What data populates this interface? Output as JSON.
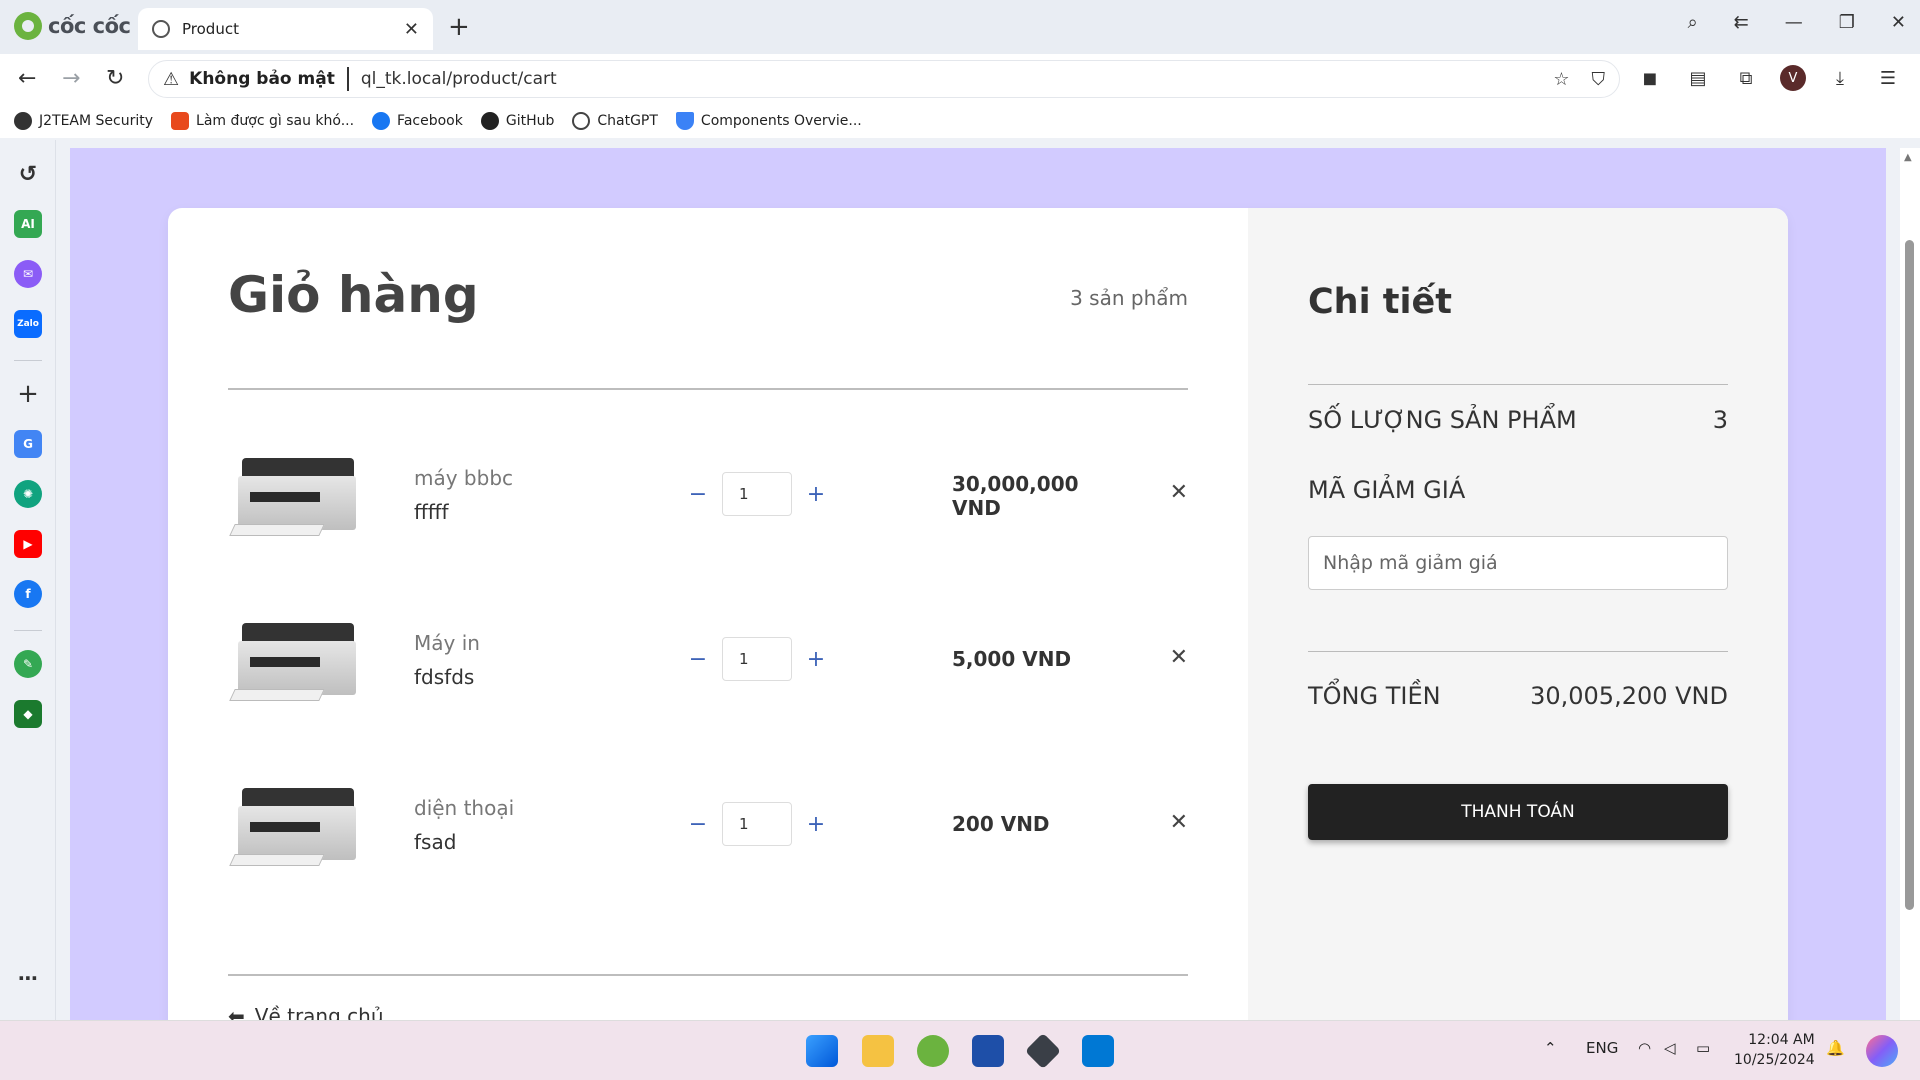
{
  "browser": {
    "brand": "cốc cốc",
    "tab_title": "Product",
    "security_label": "Không bảo mật",
    "url": "ql_tk.local/product/cart",
    "avatar_letter": "V",
    "bookmarks": [
      {
        "label": "J2TEAM Security",
        "color": "#333333"
      },
      {
        "label": "Làm được gì sau khó...",
        "color": "#e8491d"
      },
      {
        "label": "Facebook",
        "color": "#1877f2"
      },
      {
        "label": "GitHub",
        "color": "#222222"
      },
      {
        "label": "ChatGPT",
        "color": "#444444"
      },
      {
        "label": "Components Overvie...",
        "color": "#3b82f6"
      }
    ]
  },
  "sidebar": {
    "items": [
      "history-icon",
      "ai-icon",
      "messenger-icon",
      "zalo-icon",
      "add-icon",
      "translate-icon",
      "chatgpt-icon",
      "youtube-icon",
      "facebook-icon",
      "notes-icon",
      "game-icon",
      "more-icon"
    ],
    "ai_label": "AI",
    "zalo_label": "Zalo"
  },
  "cart": {
    "title": "Giỏ hàng",
    "count": "3 sản phẩm",
    "items": [
      {
        "name": "máy bbbc",
        "desc": "fffff",
        "qty": "1",
        "price": "30,000,000 VND"
      },
      {
        "name": "Máy in",
        "desc": "fdsfds",
        "qty": "1",
        "price": "5,000 VND"
      },
      {
        "name": "diện thoại",
        "desc": "fsad",
        "qty": "1",
        "price": "200 VND"
      }
    ],
    "back_label": "Về trang chủ"
  },
  "summary": {
    "title": "Chi tiết",
    "qty_label": "SỐ LƯỢNG SẢN PHẨM",
    "qty_value": "3",
    "coupon_label": "MÃ GIẢM GIÁ",
    "coupon_placeholder": "Nhập mã giảm giá",
    "total_label": "TỔNG TIỀN",
    "total_value": "30,005,200 VND",
    "checkout_label": "THANH TOÁN"
  },
  "taskbar": {
    "language": "ENG",
    "time": "12:04 AM",
    "date": "10/25/2024"
  },
  "colors": {
    "page_bg": "#d2cbff",
    "accent_qty": "#3d63b8",
    "checkout_bg": "#222222"
  }
}
